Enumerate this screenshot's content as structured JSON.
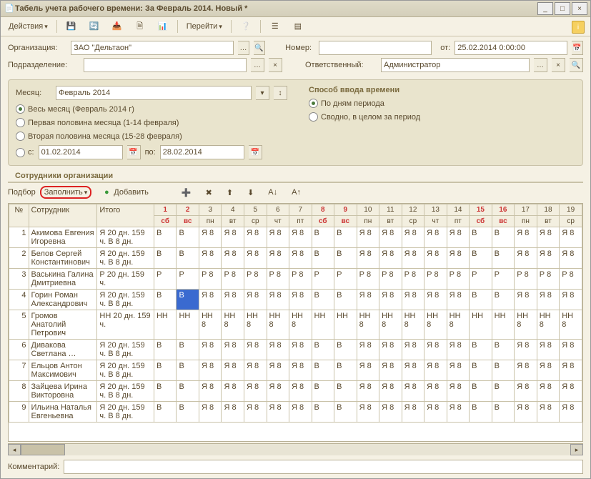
{
  "window": {
    "title": "Табель учета рабочего времени: За Февраль 2014. Новый *"
  },
  "toolbar": {
    "actions": "Действия",
    "go": "Перейти"
  },
  "form": {
    "org_label": "Организация:",
    "org_value": "ЗАО \"Дельтаон\"",
    "subdiv_label": "Подразделение:",
    "number_label": "Номер:",
    "from_label": "от:",
    "from_value": "25.02.2014  0:00:00",
    "resp_label": "Ответственный:",
    "resp_value": "Администратор"
  },
  "period": {
    "month_label": "Месяц:",
    "month_value": "Февраль 2014",
    "whole": "Весь месяц (Февраль 2014 г)",
    "first": "Первая половина месяца (1-14 февраля)",
    "second": "Вторая половина месяца (15-28 февраля)",
    "from_c": "с:",
    "from_v": "01.02.2014",
    "to_c": "по:",
    "to_v": "28.02.2014"
  },
  "mode": {
    "title": "Способ ввода времени",
    "by_days": "По дням периода",
    "summary": "Сводно, в целом за период"
  },
  "employees": {
    "title": "Сотрудники организации",
    "pick": "Подбор",
    "fill": "Заполнить",
    "add": "Добавить"
  },
  "grid": {
    "cols": {
      "num": "№",
      "emp": "Сотрудник",
      "total": "Итого"
    },
    "days": [
      {
        "n": "1",
        "w": "сб",
        "we": true
      },
      {
        "n": "2",
        "w": "вс",
        "we": true
      },
      {
        "n": "3",
        "w": "пн"
      },
      {
        "n": "4",
        "w": "вт"
      },
      {
        "n": "5",
        "w": "ср"
      },
      {
        "n": "6",
        "w": "чт"
      },
      {
        "n": "7",
        "w": "пт"
      },
      {
        "n": "8",
        "w": "сб",
        "we": true
      },
      {
        "n": "9",
        "w": "вс",
        "we": true
      },
      {
        "n": "10",
        "w": "пн"
      },
      {
        "n": "11",
        "w": "вт"
      },
      {
        "n": "12",
        "w": "ср"
      },
      {
        "n": "13",
        "w": "чт"
      },
      {
        "n": "14",
        "w": "пт"
      },
      {
        "n": "15",
        "w": "сб",
        "we": true
      },
      {
        "n": "16",
        "w": "вс",
        "we": true
      },
      {
        "n": "17",
        "w": "пн"
      },
      {
        "n": "18",
        "w": "вт"
      },
      {
        "n": "19",
        "w": "ср"
      }
    ],
    "rows": [
      {
        "n": 1,
        "emp": "Акимова Евгения Игоревна",
        "total": "Я 20 дн. 159 ч. В 8 дн.",
        "we": "В",
        "wd": "Я 8"
      },
      {
        "n": 2,
        "emp": "Белов Сергей Константинович",
        "total": "Я 20 дн. 159 ч. В 8 дн.",
        "we": "В",
        "wd": "Я 8"
      },
      {
        "n": 3,
        "emp": "Васькина Галина Дмитриевна",
        "total": "Р 20 дн. 159 ч.",
        "we": "Р",
        "wd": "Р 8"
      },
      {
        "n": 4,
        "emp": "Горин Роман Александрович",
        "total": "Я 20 дн. 159 ч. В 8 дн.",
        "we": "В",
        "wd": "Я 8",
        "sel": 2
      },
      {
        "n": 5,
        "emp": "Громов Анатолий Петрович",
        "total": "НН 20 дн. 159 ч.",
        "we": "НН",
        "wd": "НН 8"
      },
      {
        "n": 6,
        "emp": "Дивакова Светлана …",
        "total": "Я 20 дн. 159 ч. В 8 дн.",
        "we": "В",
        "wd": "Я 8"
      },
      {
        "n": 7,
        "emp": "Ельцов Антон Максимович",
        "total": "Я 20 дн. 159 ч. В 8 дн.",
        "we": "В",
        "wd": "Я 8"
      },
      {
        "n": 8,
        "emp": "Зайцева Ирина Викторовна",
        "total": "Я 20 дн. 159 ч. В 8 дн.",
        "we": "В",
        "wd": "Я 8"
      },
      {
        "n": 9,
        "emp": "Ильина Наталья Евгеньевна",
        "total": "Я 20 дн. 159 ч. В 8 дн.",
        "we": "В",
        "wd": "Я 8"
      }
    ]
  },
  "comment_label": "Комментарий:"
}
